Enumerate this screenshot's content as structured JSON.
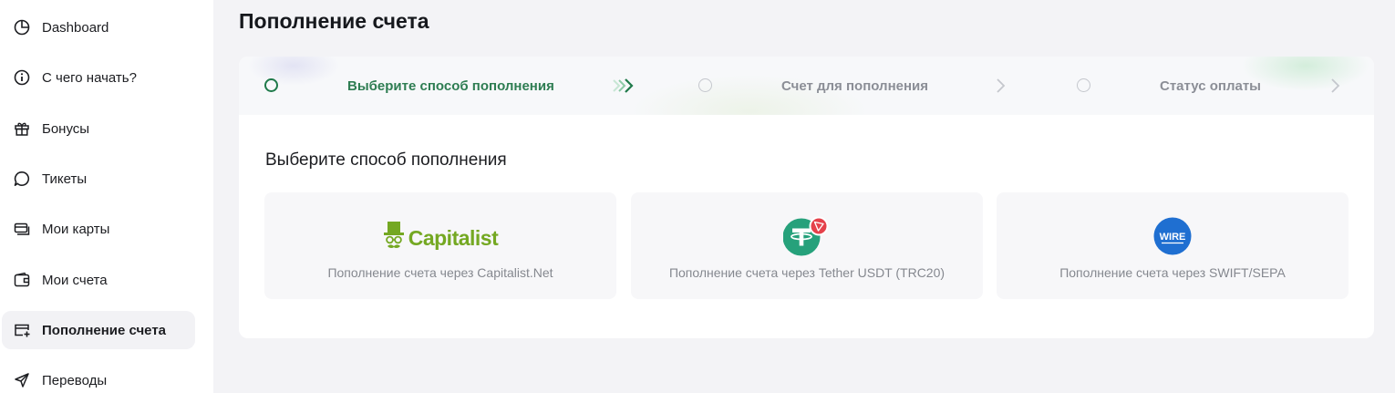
{
  "sidebar": {
    "items": [
      {
        "label": "Dashboard",
        "icon": "pie-chart-icon"
      },
      {
        "label": "С чего начать?",
        "icon": "info-icon"
      },
      {
        "label": "Бонусы",
        "icon": "gift-icon"
      },
      {
        "label": "Тикеты",
        "icon": "chat-bubble-icon"
      },
      {
        "label": "Мои карты",
        "icon": "cards-icon"
      },
      {
        "label": "Мои счета",
        "icon": "wallet-icon"
      },
      {
        "label": "Пополнение счета",
        "icon": "card-plus-icon",
        "active": true
      },
      {
        "label": "Переводы",
        "icon": "send-icon"
      }
    ]
  },
  "main": {
    "title": "Пополнение счета",
    "steps": [
      {
        "label": "Выберите способ пополнения",
        "active": true
      },
      {
        "label": "Счет для пополнения",
        "active": false
      },
      {
        "label": "Статус оплаты",
        "active": false
      }
    ],
    "section_title": "Выберите способ пополнения",
    "methods": [
      {
        "logo_text": "Capitalist",
        "description": "Пополнение счета через Capitalist.Net",
        "icon": "capitalist-logo-icon"
      },
      {
        "description": "Пополнение счета через Tether USDT (TRC20)",
        "icon": "tether-usdt-icon"
      },
      {
        "logo_text": "WIRE",
        "description": "Пополнение счета через SWIFT/SEPA",
        "icon": "wire-icon"
      }
    ]
  },
  "colors": {
    "accent_green": "#2e7d52",
    "capitalist_green": "#74a822",
    "tether_teal": "#26a17b",
    "tron_red": "#e5414b",
    "wire_blue": "#1f6fd1",
    "sidebar_bg": "#ffffff",
    "page_bg": "#f3f3f6"
  }
}
